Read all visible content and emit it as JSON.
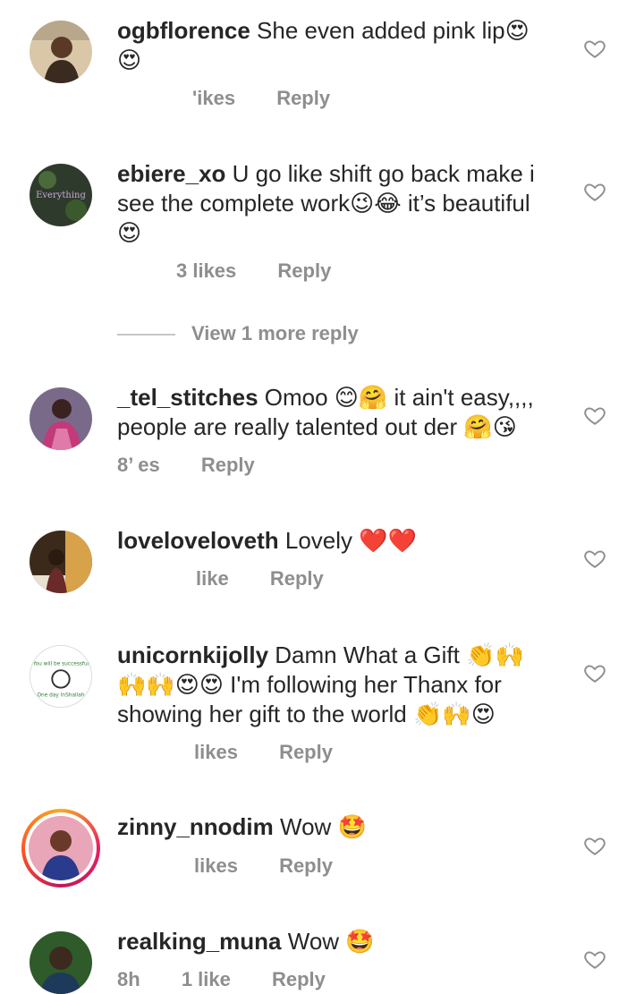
{
  "comments": [
    {
      "username": "ogbflorence",
      "text": "She even added pink lip😍 😍",
      "likes": "ʹikes",
      "reply": "Reply",
      "avatar_colors": [
        "#6b4a32",
        "#d9c7a8"
      ]
    },
    {
      "username": "ebiere_xo",
      "text": "U go like shift go back make i see the complete work😉😂 it’s beautiful 😍",
      "likes": "3 likes",
      "reply": "Reply",
      "avatar_colors": [
        "#2e3a2b",
        "#c9a7d8"
      ]
    },
    {
      "username": "_tel_stitches",
      "text": "Omoo 😊🤗 it ain't easy,,,, people are really talented out der 🤗😘",
      "likes": "8’ es",
      "reply": "Reply",
      "avatar_colors": [
        "#5a2b3c",
        "#e07aa8"
      ]
    },
    {
      "username": "loveloveloveth",
      "text": "Lovely ❤️❤️",
      "likes": "like",
      "reply": "Reply",
      "avatar_colors": [
        "#3b2a1a",
        "#d8a24a"
      ]
    },
    {
      "username": "unicornkijolly",
      "text": "Damn What a Gift 👏🙌 🙌🙌😍😍 I'm following her Thanx for showing her gift to the world 👏🙌😍",
      "likes": "likes",
      "reply": "Reply",
      "avatar_colors": [
        "#ffffff",
        "#2e7d32"
      ]
    },
    {
      "username": "zinny_nnodim",
      "text": "Wow 🤩",
      "likes": "likes",
      "reply": "Reply",
      "avatar_colors": [
        "#e9a6b8",
        "#2a3a8c"
      ]
    },
    {
      "username": "realking_muna",
      "text": "Wow 🤩",
      "time": "8h",
      "likes": "1 like",
      "reply": "Reply",
      "avatar_colors": [
        "#2f5a2a",
        "#3d2a1e"
      ]
    }
  ],
  "view_more": "View 1 more reply"
}
